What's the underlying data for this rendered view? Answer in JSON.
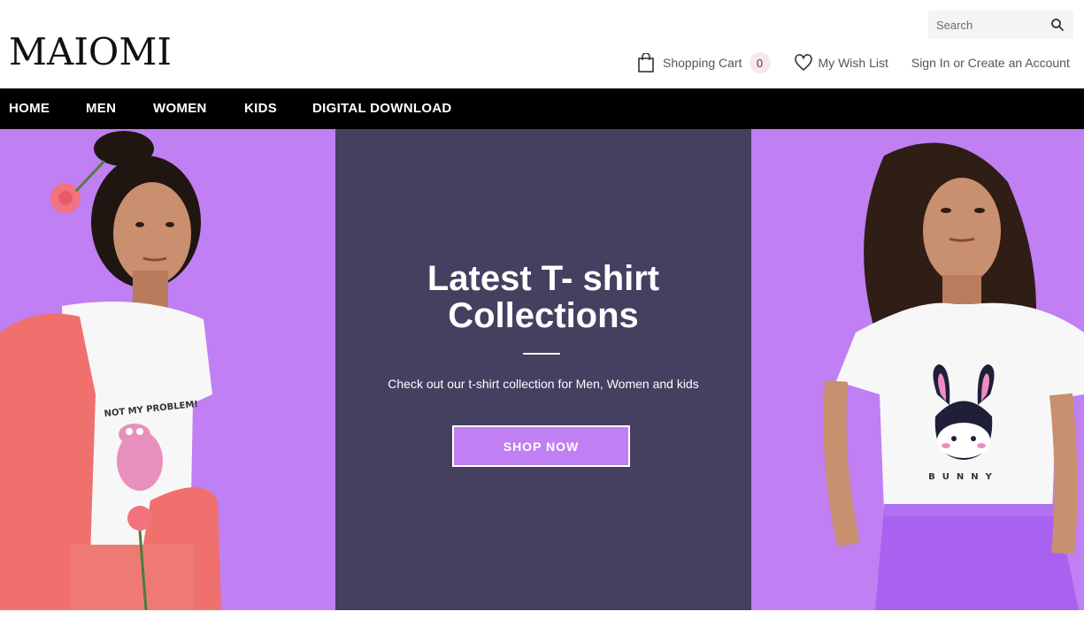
{
  "header": {
    "logo_text": "MAIOMI",
    "search": {
      "placeholder": "Search",
      "icon": "search-icon"
    },
    "cart": {
      "label": "Shopping Cart",
      "count": "0",
      "icon": "shopping-bag-icon"
    },
    "wishlist": {
      "label": "My Wish List",
      "icon": "heart-icon"
    },
    "account": {
      "label": "Sign In or Create an Account"
    }
  },
  "nav": {
    "items": [
      "HOME",
      "MEN",
      "WOMEN",
      "KIDS",
      "DIGITAL DOWNLOAD"
    ]
  },
  "hero": {
    "title_line1": "Latest T- shirt",
    "title_line2": "Collections",
    "subtitle": "Check out our t-shirt collection for Men, Women and kids",
    "button_label": "SHOP NOW",
    "left_shirt_text": "NOT MY PROBLEM!",
    "right_shirt_text": "BUNNY"
  },
  "colors": {
    "hero_purple": "#c07ff2",
    "hero_center": "#453f60",
    "nav_bg": "#000000",
    "button_bg": "#c080f4",
    "cart_badge": "#fbe6ea",
    "logo_green": "#2e8b57"
  }
}
